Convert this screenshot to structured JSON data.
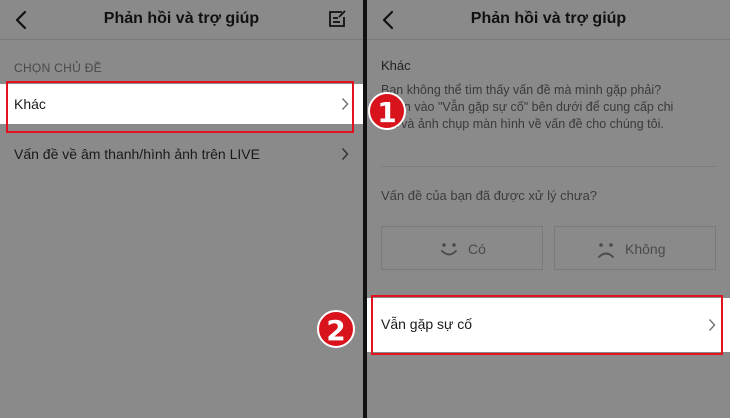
{
  "left": {
    "header": {
      "title": "Phản hồi và trợ giúp"
    },
    "section_label": "CHỌN CHỦ ĐỀ",
    "rows": [
      {
        "label": "Khác"
      },
      {
        "label": "Vấn đề về âm thanh/hình ảnh trên LIVE"
      }
    ]
  },
  "right": {
    "header": {
      "title": "Phản hồi và trợ giúp"
    },
    "topic": "Khác",
    "description_lines": [
      "Bạn không thể tìm thấy vấn đề mà mình gặp phải?",
      "Chọn vào \"Vẫn gặp sự cố\" bên dưới để cung cấp chi",
      "tiết và ảnh chụp màn hình về vấn đề cho chúng tôi."
    ],
    "question": "Vấn đề của bạn đã được xử lý chưa?",
    "vote_yes": "Có",
    "vote_no": "Không",
    "still_issue": "Vẫn gặp sự cố"
  },
  "markers": [
    "1",
    "2"
  ],
  "colors": {
    "highlight": "#e1131f",
    "marker": "#d8131c",
    "dim_bg": "#8a8a8a"
  }
}
